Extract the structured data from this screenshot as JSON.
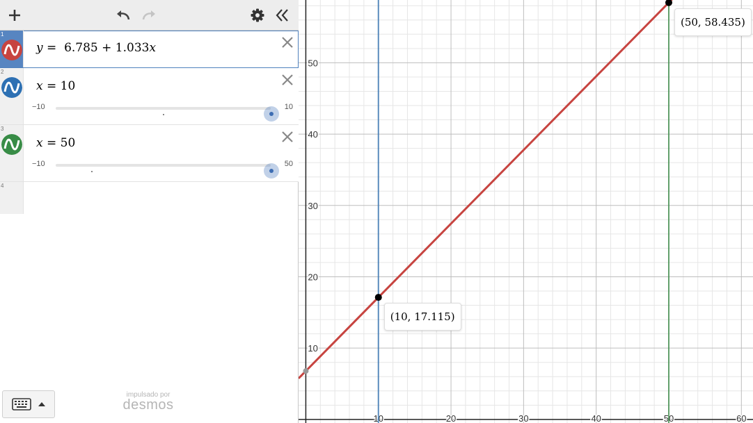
{
  "toolbar": {
    "add_icon": "plus-icon",
    "undo_icon": "undo-icon",
    "redo_icon": "redo-icon",
    "settings_icon": "gear-icon",
    "collapse_icon": "double-chevron-left-icon"
  },
  "expressions": [
    {
      "index": "1",
      "color": "#c74440",
      "lhs": "y",
      "rhs": " =  6.785 + 1.033",
      "var": "x"
    },
    {
      "index": "2",
      "color": "#2d70b3",
      "lhs": "x",
      "rhs": " = 10",
      "slider": {
        "min": "−10",
        "max": "10",
        "value": 10
      }
    },
    {
      "index": "3",
      "color": "#388c46",
      "lhs": "x",
      "rhs": " = 50",
      "slider": {
        "min": "−10",
        "max": "50",
        "value": 50
      }
    },
    {
      "index": "4"
    }
  ],
  "branding": {
    "powered_by": "impulsado por",
    "name": "desmos"
  },
  "graph": {
    "x_range": [
      -1,
      61.6
    ],
    "y_range": [
      -0.5,
      58.8
    ],
    "x_ticks": [
      "10",
      "20",
      "30",
      "40",
      "50",
      "60"
    ],
    "y_ticks": [
      "10",
      "20",
      "30",
      "40",
      "50"
    ],
    "line": {
      "intercept": 6.785,
      "slope": 1.033,
      "color": "#c74440"
    },
    "vlines": [
      {
        "x": 10,
        "color": "#2d70b3"
      },
      {
        "x": 50,
        "color": "#388c46"
      }
    ],
    "points": [
      {
        "x": 10,
        "y": 17.115,
        "label": "(10, 17.115)"
      },
      {
        "x": 50,
        "y": 58.435,
        "label": "(50, 58.435)"
      }
    ],
    "y_intercept_y": 6.785
  }
}
